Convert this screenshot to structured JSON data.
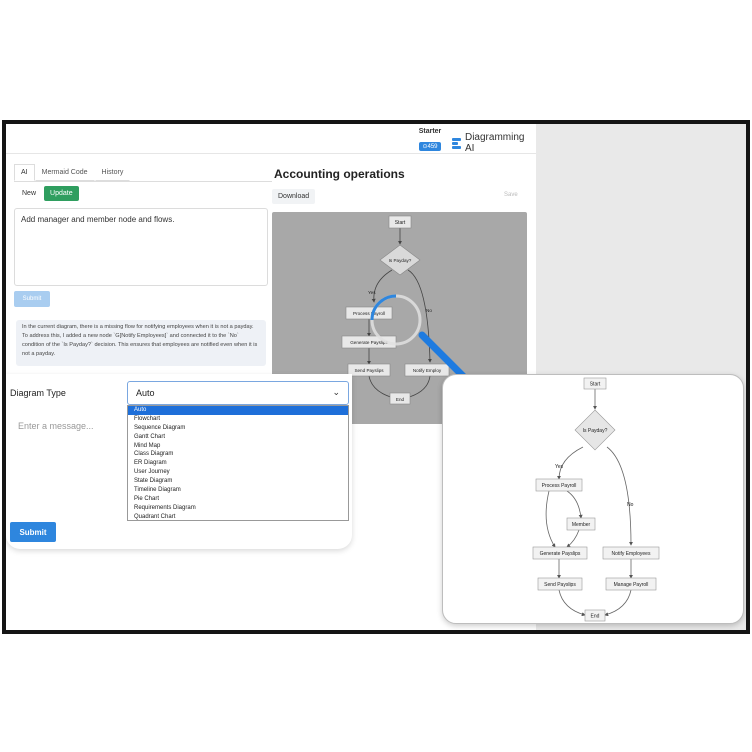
{
  "header": {
    "plan_label": "Starter",
    "credits": "⊙459",
    "brand": "Diagramming AI"
  },
  "tabs": [
    {
      "label": "AI"
    },
    {
      "label": "Mermaid Code"
    },
    {
      "label": "History"
    }
  ],
  "mode": {
    "new_label": "New",
    "update_label": "Update"
  },
  "prompt": {
    "value": "Add manager and member node and flows."
  },
  "submit_disabled_label": "Submit",
  "explanation": "In the current diagram, there is a missing flow for notifying employees when it is not a payday. To address this, I added a new node `G[Notify Employees]` and connected it to the `No` condition of the `Is Payday?` decision. This ensures that employees are notified even when it is not a payday.",
  "document": {
    "title": "Accounting operations",
    "download_label": "Download",
    "save_label": "Save"
  },
  "diagram_type": {
    "label": "Diagram Type",
    "selected": "Auto",
    "options": [
      "Auto",
      "Flowchart",
      "Sequence Diagram",
      "Gantt Chart",
      "Mind Map",
      "Class Diagram",
      "ER Diagram",
      "User Journey",
      "State Diagram",
      "Timeline Diagram",
      "Pie Chart",
      "Requirements Diagram",
      "Quadrant Chart"
    ]
  },
  "message": {
    "placeholder": "Enter a message..."
  },
  "submit_label": "Submit",
  "diagram": {
    "start": "Start",
    "decision": "Is Payday?",
    "yes": "Yes",
    "no": "No",
    "process_payroll": "Process Payroll",
    "member": "Member",
    "generate_payslips": "Generate Payslips",
    "notify_employees": "Notify Employees",
    "notify_employees_clipped": "Notify Employ",
    "send_payslips": "Send Payslips",
    "manage_payroll": "Manage Payroll",
    "end": "End"
  },
  "colors": {
    "accent": "#2e86de",
    "update_green": "#2f9e5f",
    "arrow_blue": "#1e7be0"
  }
}
